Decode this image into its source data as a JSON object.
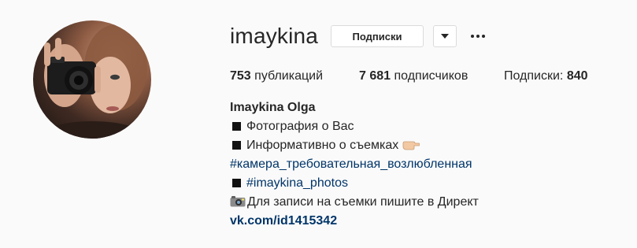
{
  "profile": {
    "username": "imaykina",
    "follow_button_label": "Подписки",
    "dropdown_icon": "chevron-down-icon",
    "more_icon": "more-horizontal-icon"
  },
  "stats": {
    "posts_count": "753",
    "posts_label": "публикаций",
    "followers_count": "7 681",
    "followers_label": "подписчиков",
    "following_label": "Подписки:",
    "following_count": "840"
  },
  "bio": {
    "full_name": "Imaykina Olga",
    "line1": "Фотография о Вас",
    "line2": "Информативно о съемках",
    "hashtag1": "#камера_требовательная_возлюбленная",
    "hashtag2": "#imaykina_photos",
    "line5": "Для записи на съемки пишите в Директ",
    "website": "vk.com/id1415342"
  },
  "colors": {
    "background": "#fafafa",
    "text": "#262626",
    "link": "#003569",
    "border": "#dbdbdb"
  }
}
